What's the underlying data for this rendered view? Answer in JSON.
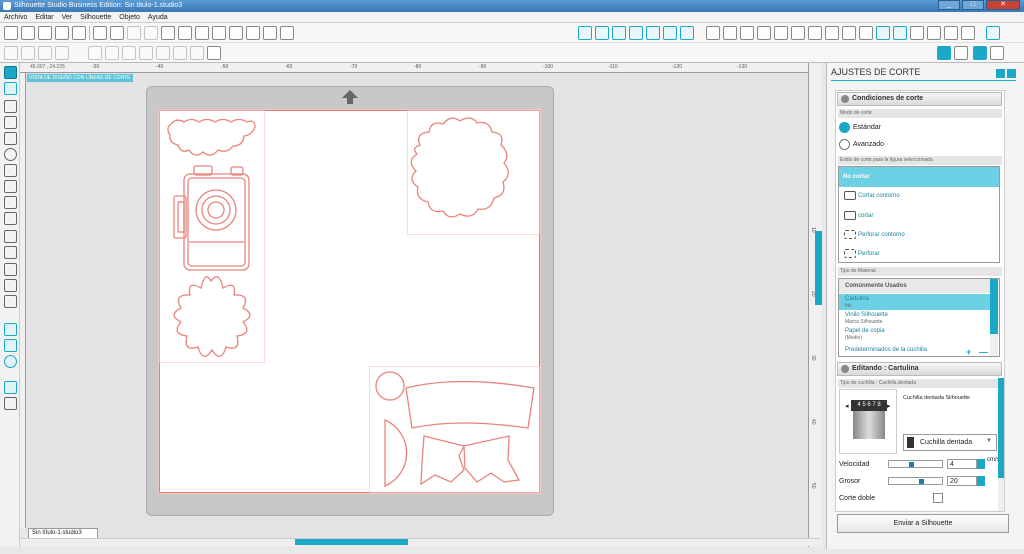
{
  "window": {
    "title": "Silhouette Studio Business Edition: Sin titulo-1.studio3",
    "min": "_",
    "max": "□",
    "close": "✕"
  },
  "menu": [
    "Archivo",
    "Editar",
    "Ver",
    "Silhouette",
    "Objeto",
    "Ayuda"
  ],
  "ruler": {
    "top_labels": [
      "-30",
      "-40",
      "-50",
      "-60",
      "-70",
      "-80",
      "-90",
      "-100",
      "-110",
      "-120",
      "-130",
      "-140",
      "-150",
      "-160",
      "-170"
    ],
    "left_labels": [
      "10",
      "20",
      "30",
      "40",
      "50"
    ]
  },
  "canvas": {
    "mode_label": "VISTA DE DISEÑO CON LÍNEAS DE CORTE",
    "coords": "45.007 , 24.225"
  },
  "document_tab": {
    "label": "Sin título-1.studio3"
  },
  "panel": {
    "title": "AJUSTES DE CORTE",
    "cut_conditions": {
      "header": "Condiciones de corte",
      "mode_label": "Modo de corte",
      "standard": "Estándar",
      "advanced": "Avanzado",
      "style_label": "Estilo de corte para la figura seleccionada",
      "styles": [
        "No cortar",
        "Cortar contorno",
        "cortar",
        "Perforar contorno",
        "Perforar"
      ]
    },
    "material": {
      "label": "Tipo de Material",
      "group": "Comúnmente Usados",
      "items": [
        {
          "name": "Cartulina",
          "sub": "Ink"
        },
        {
          "name": "Vinilo Silhouette",
          "sub": "Marca Silhouette"
        },
        {
          "name": "Papel de copia",
          "sub": "(Medio)"
        },
        {
          "name": "Predeterminados de la cuchilla",
          "sub": ""
        }
      ],
      "add": "+",
      "remove": "—"
    },
    "editing": {
      "header": "Editando : Cartulina",
      "blade_label": "Tipo de cuchilla : Cuchilla dentada",
      "blade_name": "Cuchilla dentada Silhouette",
      "blade_select": "Cuchilla dentada",
      "blade_digits": "4 5 6 7 8"
    },
    "speed": {
      "label": "Velocidad",
      "value": "4",
      "unit": "cm/s",
      "level": 0.4
    },
    "thickness": {
      "label": "Grosor",
      "value": "20",
      "level": 0.6
    },
    "double_cut": {
      "label": "Corte doble"
    },
    "send_button": "Enviar a Silhouette"
  }
}
